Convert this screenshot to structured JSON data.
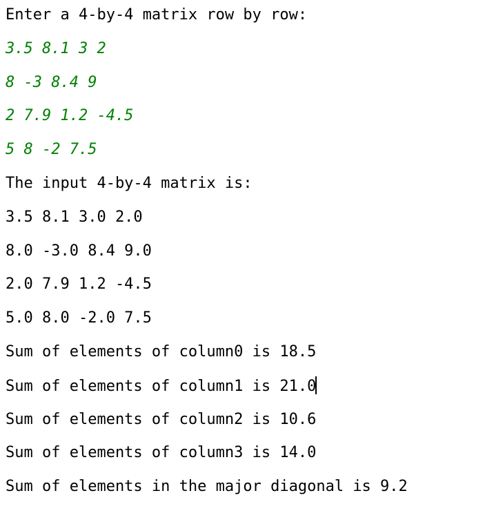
{
  "console": {
    "input_color": "#008000",
    "output_color": "#000000",
    "lines": [
      {
        "text": "Enter a 4-by-4 matrix row by row:",
        "kind": "output"
      },
      {
        "text": "3.5 8.1 3 2",
        "kind": "input"
      },
      {
        "text": "8 -3 8.4 9",
        "kind": "input"
      },
      {
        "text": "2 7.9 1.2 -4.5",
        "kind": "input"
      },
      {
        "text": "5 8 -2 7.5",
        "kind": "input"
      },
      {
        "text": "The input 4-by-4 matrix is:",
        "kind": "output"
      },
      {
        "text": "3.5 8.1 3.0 2.0",
        "kind": "output"
      },
      {
        "text": "8.0 -3.0 8.4 9.0",
        "kind": "output"
      },
      {
        "text": "2.0 7.9 1.2 -4.5",
        "kind": "output"
      },
      {
        "text": "5.0 8.0 -2.0 7.5",
        "kind": "output"
      },
      {
        "text": "Sum of elements of column0 is 18.5",
        "kind": "output"
      },
      {
        "text": "Sum of elements of column1 is 21.0",
        "kind": "output"
      },
      {
        "text": "Sum of elements of column2 is 10.6",
        "kind": "output"
      },
      {
        "text": "Sum of elements of column3 is 14.0",
        "kind": "output"
      },
      {
        "text": "Sum of elements in the major diagonal is 9.2",
        "kind": "output"
      }
    ]
  }
}
